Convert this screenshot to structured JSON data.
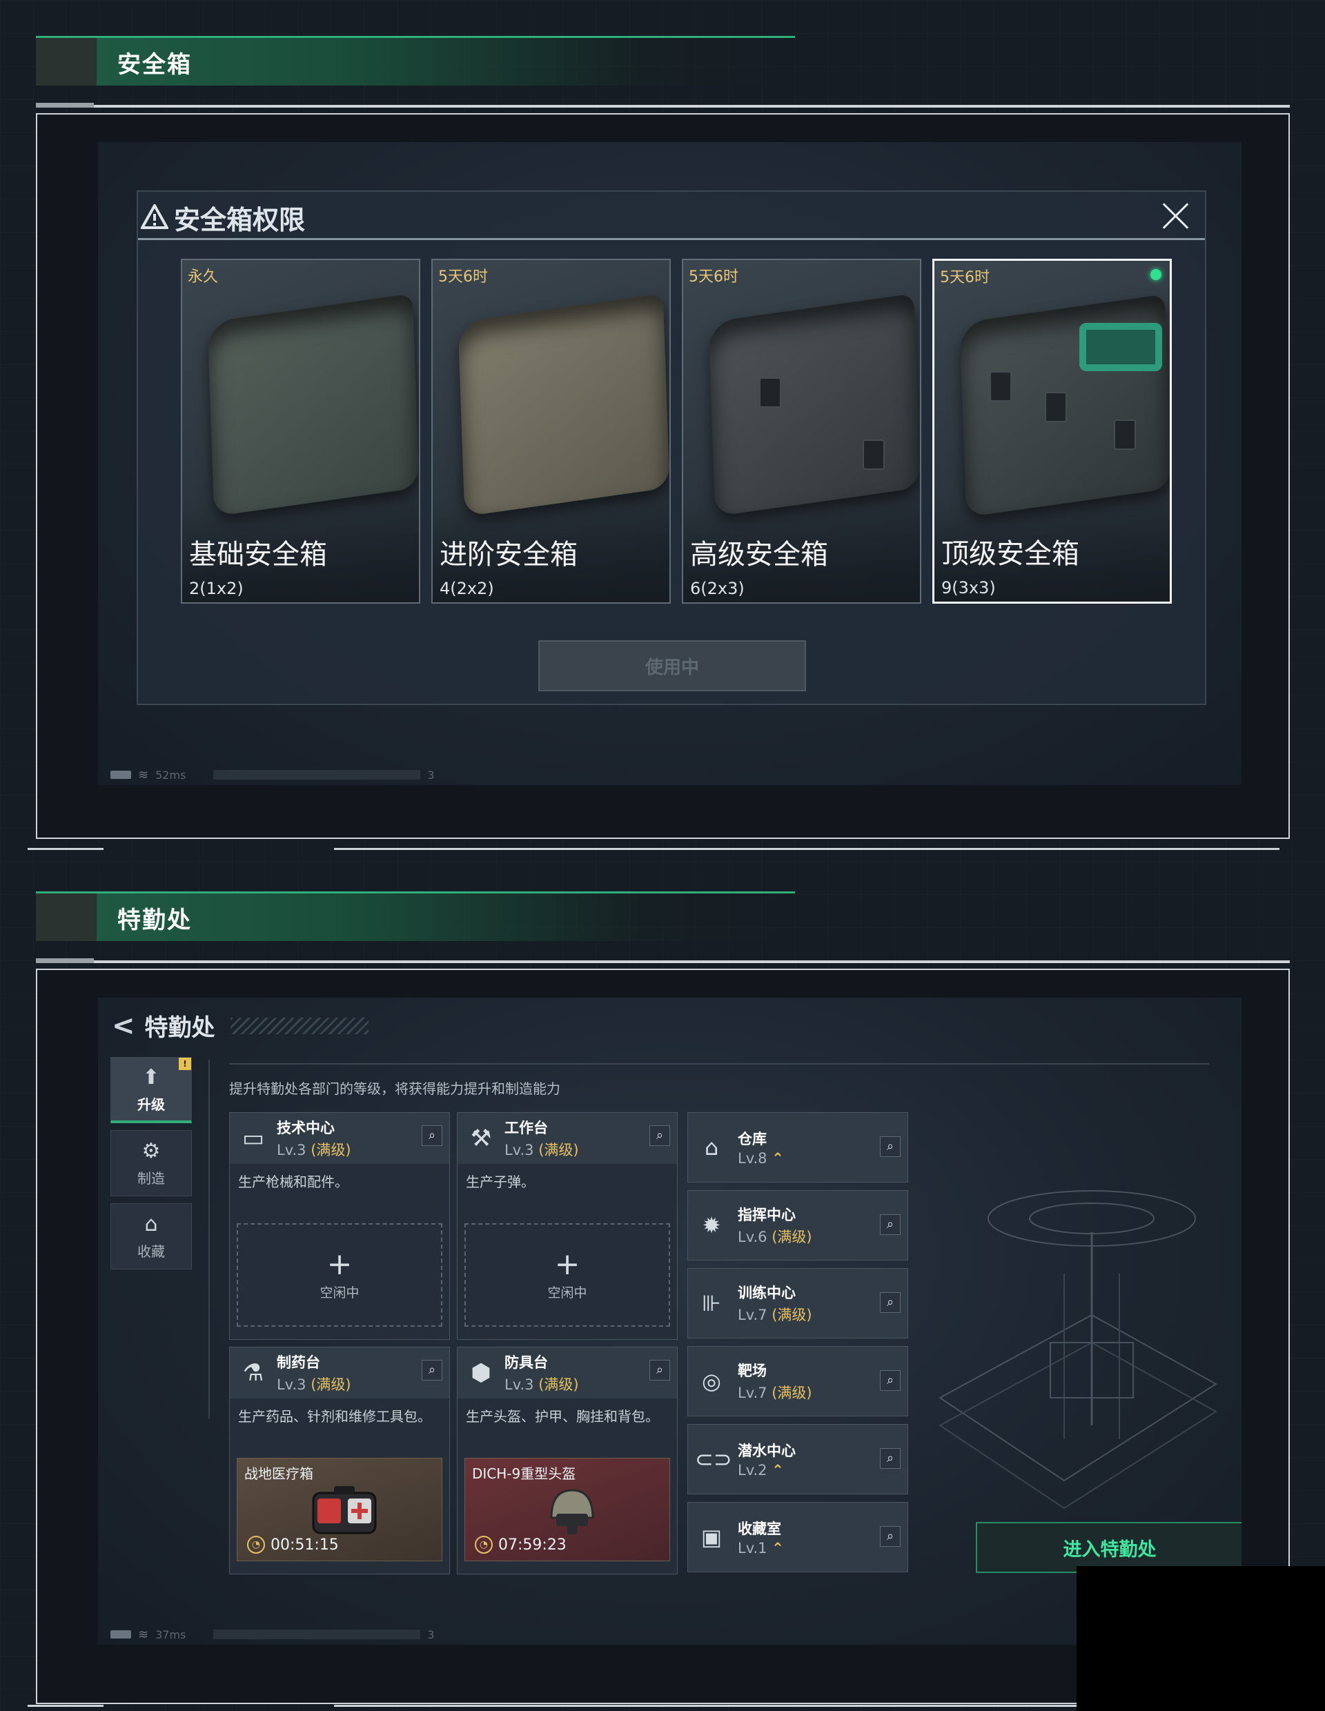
{
  "sections": {
    "safebox_header": "安全箱",
    "ops_header": "特勤处"
  },
  "safebox_dialog": {
    "title": "安全箱权限",
    "cards": [
      {
        "duration": "永久",
        "name": "基础安全箱",
        "capacity": "2(1x2)",
        "selected": false
      },
      {
        "duration": "5天6时",
        "name": "进阶安全箱",
        "capacity": "4(2x2)",
        "selected": false
      },
      {
        "duration": "5天6时",
        "name": "高级安全箱",
        "capacity": "6(2x3)",
        "selected": false
      },
      {
        "duration": "5天6时",
        "name": "顶级安全箱",
        "capacity": "9(3x3)",
        "selected": true
      }
    ],
    "use_button": "使用中",
    "status": {
      "ping": "52ms",
      "page": "3"
    }
  },
  "ops": {
    "title": "特勤处",
    "description": "提升特勤处各部门的等级，将获得能力提升和制造能力",
    "nav": [
      {
        "label": "升级",
        "icon": "upgrade-icon",
        "active": true
      },
      {
        "label": "制造",
        "icon": "gear-icon",
        "active": false
      },
      {
        "label": "收藏",
        "icon": "collection-icon",
        "active": false
      }
    ],
    "nav_badge": "!",
    "workshops": [
      {
        "name": "技术中心",
        "level": "Lv.3",
        "max_tag": "(满级)",
        "desc": "生产枪械和配件。",
        "slot": "空闲中"
      },
      {
        "name": "工作台",
        "level": "Lv.3",
        "max_tag": "(满级)",
        "desc": "生产子弹。",
        "slot": "空闲中"
      },
      {
        "name": "制药台",
        "level": "Lv.3",
        "max_tag": "(满级)",
        "desc": "生产药品、针剂和维修工具包。",
        "item": "战地医疗箱",
        "timer": "00:51:15"
      },
      {
        "name": "防具台",
        "level": "Lv.3",
        "max_tag": "(满级)",
        "desc": "生产头盔、护甲、胸挂和背包。",
        "item": "DICH-9重型头盔",
        "timer": "07:59:23"
      }
    ],
    "facilities": [
      {
        "name": "仓库",
        "level": "Lv.8",
        "max_tag": "",
        "upgradable": true
      },
      {
        "name": "指挥中心",
        "level": "Lv.6",
        "max_tag": "(满级)",
        "upgradable": false
      },
      {
        "name": "训练中心",
        "level": "Lv.7",
        "max_tag": "(满级)",
        "upgradable": false
      },
      {
        "name": "靶场",
        "level": "Lv.7",
        "max_tag": "(满级)",
        "upgradable": false
      },
      {
        "name": "潜水中心",
        "level": "Lv.2",
        "max_tag": "",
        "upgradable": true
      },
      {
        "name": "收藏室",
        "level": "Lv.1",
        "max_tag": "",
        "upgradable": true
      }
    ],
    "up_glyph": "⌃",
    "plus_glyph": "+",
    "enter_button": "进入特勤处",
    "status": {
      "ping": "37ms",
      "page": "3"
    }
  },
  "colors": {
    "accent_green": "#2fb07a",
    "gold": "#e6c060",
    "enter_green": "#3ee8a0"
  }
}
